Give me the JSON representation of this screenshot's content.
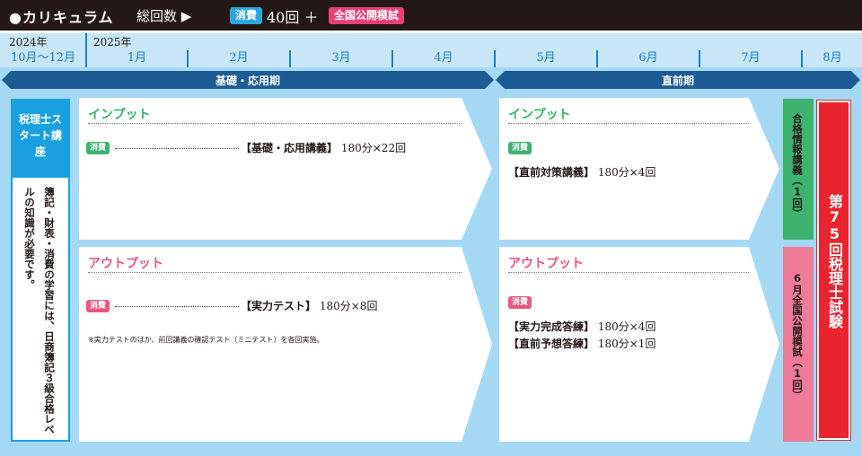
{
  "header": {
    "title": "●カリキュラム",
    "count_label": "総回数 ▶",
    "subject_badge": "消費",
    "sessions": "40回 ＋",
    "mock_badge": "全国公開模試"
  },
  "timeline": {
    "years": [
      "2024年",
      "2025年"
    ],
    "months": [
      "10月〜12月",
      "1月",
      "2月",
      "3月",
      "4月",
      "5月",
      "6月",
      "7月",
      "8月"
    ]
  },
  "phases": [
    "基礎・応用期",
    "直前期"
  ],
  "starter": {
    "title": "税理士スタート講座",
    "note": "簿記・財表・消費の学習には、日商簿記３級合格レベルの知識が必要です。"
  },
  "basic": {
    "input": {
      "heading": "インプット",
      "tag": "消費",
      "course": "【基礎・応用講義】",
      "detail": "180分×22回"
    },
    "output": {
      "heading": "アウトプット",
      "tag": "消費",
      "course": "【実力テスト】",
      "detail": "180分×8回",
      "note": "※実力テストのほか、前回講義の確認テスト（ミニテスト）を各回実施。"
    }
  },
  "final": {
    "input": {
      "heading": "インプット",
      "tag": "消費",
      "course": "【直前対策講義】",
      "detail": "180分×4回"
    },
    "output": {
      "heading": "アウトプット",
      "tag": "消費",
      "items": [
        {
          "course": "【実力完成答練】",
          "detail": "180分×4回"
        },
        {
          "course": "【直前予想答練】",
          "detail": "180分×1回"
        }
      ]
    }
  },
  "side": {
    "info_lecture": "合格情報講義（1回）",
    "mock_exam": "6月全国公開模試（1回）",
    "exam": "第75回税理士試験"
  },
  "colors": {
    "input_green": "#3cb371",
    "output_pink": "#e8577f",
    "subject_blue": "#29a8e0",
    "mock_pink": "#ea3f76",
    "exam_red": "#e8242e",
    "info_green": "#3db36e",
    "mock_side_pink": "#ef7b98",
    "timeline_blue": "#1a7fcc",
    "phase_navy": "#1d5b95"
  }
}
